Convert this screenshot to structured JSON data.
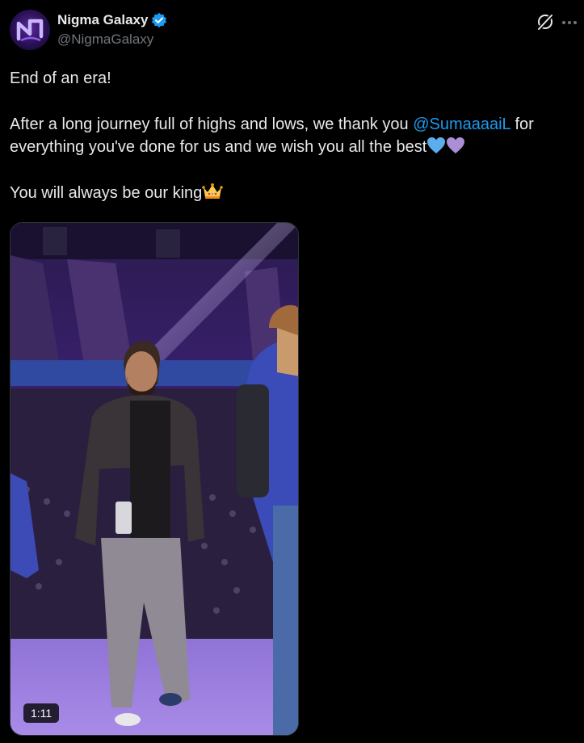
{
  "author": {
    "display_name": "Nigma Galaxy",
    "handle": "@NigmaGalaxy",
    "avatar_icon": "nigma-galaxy-logo",
    "verified": true,
    "verified_color": "#1d9bf0"
  },
  "header_actions": {
    "grok_icon": "grok-icon",
    "more_icon": "more-options-icon"
  },
  "tweet": {
    "line1": "End of an era!",
    "line2_pre": "After a long journey full of highs and lows, we thank you ",
    "mention": "@SumaaaaiL",
    "line2_post": " for",
    "line3": "everything you've done for us and we wish you all the best",
    "line3_emojis": [
      "blue-heart-emoji",
      "purple-heart-emoji"
    ],
    "line4": "You will always be our king",
    "line4_emoji": "crown-emoji"
  },
  "media": {
    "type": "video",
    "duration": "1:11"
  },
  "colors": {
    "background": "#000000",
    "text": "#e7e9ea",
    "secondary": "#71767b",
    "link": "#1d9bf0"
  }
}
